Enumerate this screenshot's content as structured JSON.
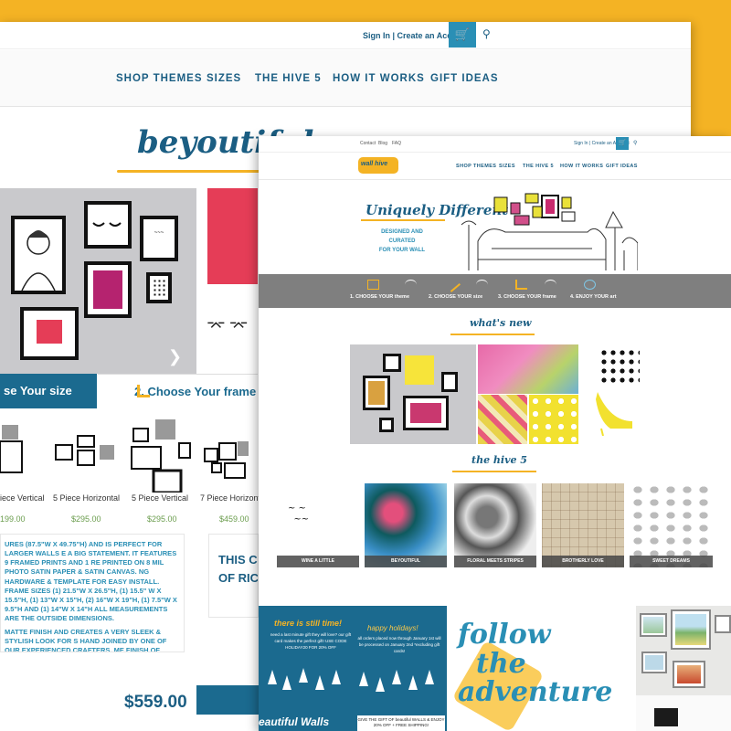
{
  "back_page": {
    "header": {
      "signin": "Sign In | Create an Account",
      "cart_icon": "cart-icon",
      "search_icon": "search-icon"
    },
    "nav": [
      "SHOP THEMES",
      "SIZES",
      "THE HIVE 5",
      "HOW IT WORKS",
      "GIFT IDEAS"
    ],
    "product_title": "beyoutiful",
    "steps": {
      "step1": "se Your size",
      "step2": "2. Choose Your frame"
    },
    "sizes": [
      {
        "label": "iece Vertical",
        "price": "199.00"
      },
      {
        "label": "5 Piece Horizontal",
        "price": "$295.00"
      },
      {
        "label": "5 Piece Vertical",
        "price": "$295.00"
      },
      {
        "label": "7 Piece Horizont",
        "price": "$459.00"
      }
    ],
    "description": [
      "URES (87.5\"W X 49.75\"H) AND IS PERFECT FOR LARGER WALLS E A BIG STATEMENT. IT FEATURES 9 FRAMED PRINTS AND 1 RE PRINTED ON 8 MIL PHOTO SATIN PAPER & SATIN CANVAS. NG HARDWARE & TEMPLATE FOR EASY INSTALL. FRAME SIZES (1) 21.5\"W X 26.5\"H, (1) 15.5\" W X 15.5\"H, (1) 13\"W X 15\"H, (2) 16\"W X 19\"H, (1) 7.5\"W X 9.5\"H AND (1) 14\"W X 14\"H ALL MEASUREMENTS ARE THE OUTSIDE DIMENSIONS.",
      "MATTE FINISH AND CREATES A VERY SLEEK & STYLISH LOOK FOR S HAND JOINED BY ONE OF OUR EXPERIENCED CRAFTERS. ME FINISH OF MOULDING AT DIFFERENT DEPTHS TO CREATE A M LOOK WITH SOME VISUAL INTEREST."
    ],
    "condition_text": [
      "THIS CO",
      "OF RICH"
    ],
    "price": "$559.00"
  },
  "front_page": {
    "toplinks": [
      "Contact",
      "Blog",
      "FAQ"
    ],
    "signin": "Sign In | Create an Account",
    "logo_text": "wall hive",
    "nav": [
      "SHOP THEMES",
      "SIZES",
      "THE HIVE 5",
      "HOW IT WORKS",
      "GIFT IDEAS"
    ],
    "hero": {
      "title": "Uniquely Different",
      "subtitle_lines": [
        "DESIGNED AND",
        "CURATED",
        "FOR YOUR WALL"
      ]
    },
    "steps": [
      "1. CHOOSE YOUR theme",
      "2. CHOOSE YOUR size",
      "3. CHOOSE YOUR frame",
      "4. ENJOY YOUR art"
    ],
    "whats_new_title": "what's new",
    "hive5_title": "the hive 5",
    "hive5": [
      "WINE A LITTLE",
      "BEYOUTIFUL",
      "FLORAL MEETS STRIPES",
      "BROTHERLY LOVE",
      "SWEET DREAMS"
    ],
    "promo": {
      "title1": "there is still time!",
      "text1": "need a last minute gift they will love? our gift card makes the perfect gift! USE CODE HOLIDAY20 FOR 20% OFF",
      "title2": "happy holidays!",
      "text2": "all orders placed now through January 1st will be processed on January 2nd *excluding gift cards!",
      "gift": "GIVE THE GIFT OF beautiful WALLS & ENJOY 20% OFF + FREE SHIPPING!",
      "bottom": "eautiful Walls"
    },
    "follow": [
      "follow",
      "the",
      "adventure"
    ]
  },
  "colors": {
    "brand_blue": "#1b5e83",
    "accent_yellow": "#f4b324",
    "cart_blue": "#2a8fb5",
    "steps_gray": "#7f7f7f"
  }
}
